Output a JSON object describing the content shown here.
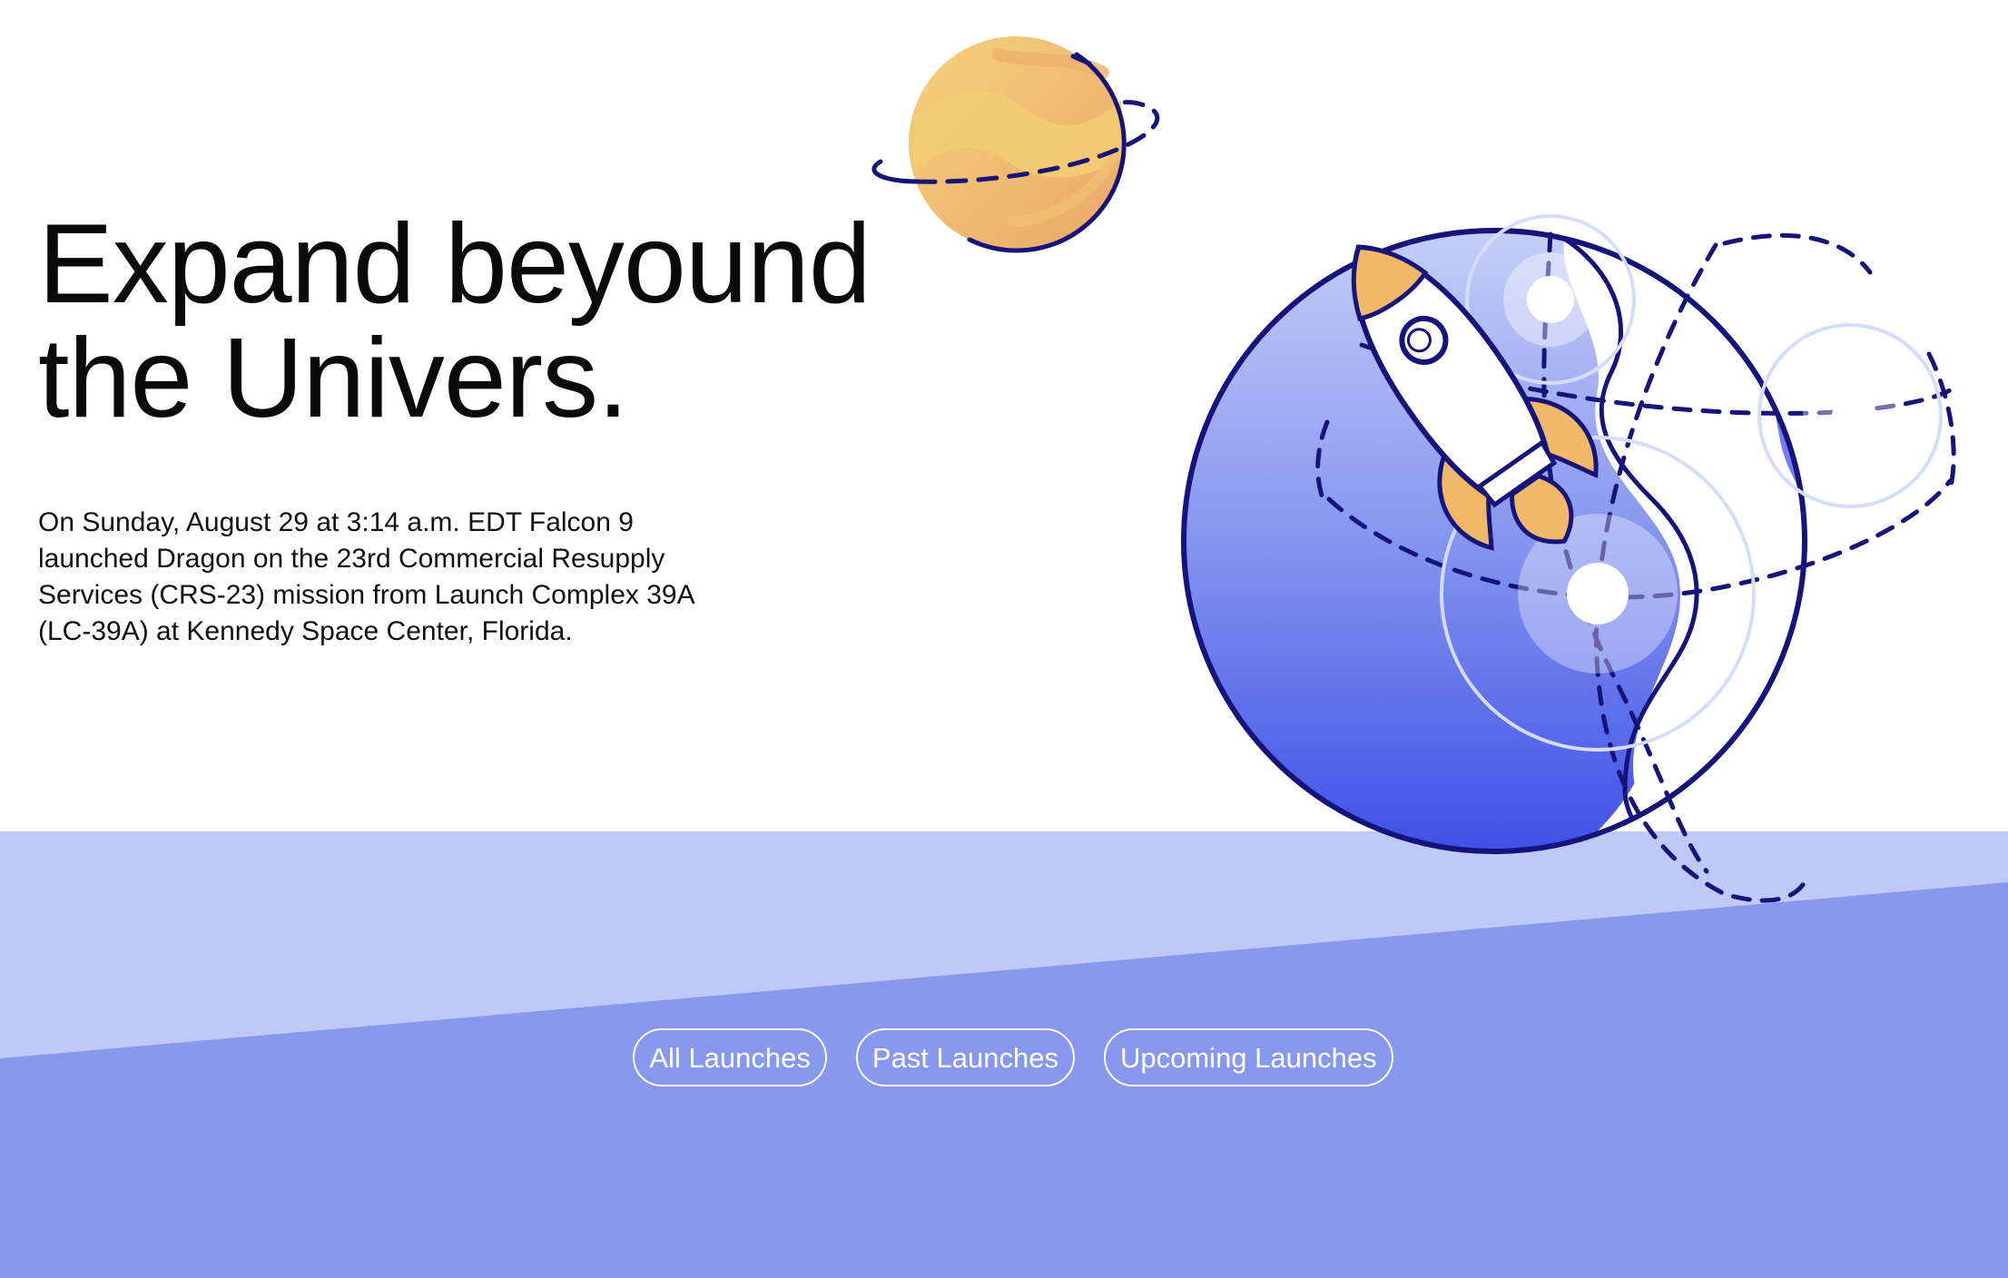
{
  "hero": {
    "headline_line1": "Expand beyound",
    "headline_line2": "the Univers.",
    "description": "On Sunday, August 29 at 3:14 a.m. EDT Falcon 9 launched Dragon on the 23rd Commercial Resupply Services (CRS-23) mission from Launch Complex 39A (LC-39A) at Kennedy Space Center, Florida."
  },
  "nav": {
    "buttons": [
      {
        "label": "All Launches",
        "icon": "none"
      },
      {
        "label": "Past Launches",
        "icon": "none"
      },
      {
        "label": "Upcoming Launches",
        "icon": "none"
      }
    ]
  },
  "illustration": {
    "icons": [
      "planet-icon",
      "globe-icon",
      "rocket-icon",
      "location-pin-icon"
    ]
  },
  "colors": {
    "light_band": "#c0c9f6",
    "dark_band": "#8798ee",
    "navy_outline": "#16137a",
    "globe_blue": "#4a5eea",
    "planet_orange": "#f2c36d",
    "text": "#0a0a0a",
    "background": "#ffffff"
  }
}
